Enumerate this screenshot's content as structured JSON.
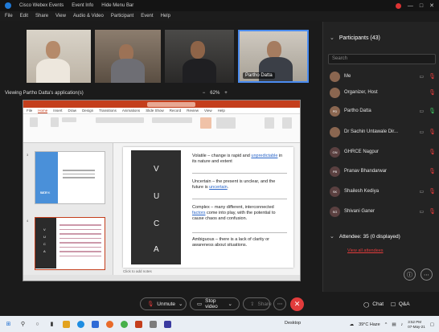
{
  "titlebar": {
    "items": [
      "Cisco Webex Events",
      "Event Info",
      "Hide Menu Bar"
    ],
    "minimize": "—",
    "maximize": "□",
    "close": "✕"
  },
  "menubar": [
    "File",
    "Edit",
    "Share",
    "View",
    "Audio & Video",
    "Participant",
    "Event",
    "Help"
  ],
  "videos": {
    "active_speaker_label": "Partho Datta"
  },
  "share_bar": {
    "viewing_text": "Viewing Partho Datta's application(s)",
    "zoom_out": "−",
    "zoom_level": "62%",
    "zoom_in": "+"
  },
  "ppt": {
    "tabs": [
      "File",
      "Home",
      "Insert",
      "Draw",
      "Design",
      "Transitions",
      "Animations",
      "Slide Show",
      "Record",
      "Review",
      "View",
      "Help"
    ],
    "slide_numbers": [
      "3",
      "4"
    ],
    "thumb1_title": [
      "SET",
      "WORK"
    ],
    "vuca_letters": [
      "V",
      "U",
      "C",
      "A"
    ],
    "slide_text": [
      {
        "prefix": "Volatile – change is rapid and ",
        "hl": "unpredictable",
        "suffix": " in its nature and extent"
      },
      {
        "prefix": "Uncertain – the present is unclear, and the future is ",
        "hl": "uncertain",
        "suffix": "."
      },
      {
        "prefix": "Complex – many different, interconnected ",
        "hl": "factors",
        "suffix": " come into play, with the potential to cause chaos and confusion."
      },
      {
        "prefix": "Ambiguous – there is a lack of clarity or awareness about situations.",
        "hl": "",
        "suffix": ""
      }
    ],
    "notes_placeholder": "Click to add notes"
  },
  "participants": {
    "title": "Participants (43)",
    "search_placeholder": "Search",
    "rows": [
      {
        "name": "Me",
        "avatar": "",
        "photo": true
      },
      {
        "name": "Organizer, Host",
        "avatar": "",
        "photo": true
      },
      {
        "name": "Partho Datta",
        "avatar": "PD",
        "photo": true
      },
      {
        "name": "Dr Sachin Untawale Dir...",
        "avatar": "",
        "photo": true
      },
      {
        "name": "GHRCE Nagpur",
        "avatar": "GN",
        "photo": false
      },
      {
        "name": "Pranav Bhandarwar",
        "avatar": "PB",
        "photo": false
      },
      {
        "name": "Shailesh Kediya",
        "avatar": "SK",
        "photo": false
      },
      {
        "name": "Shivani Ganer",
        "avatar": "SG",
        "photo": false
      }
    ],
    "attendee_header": "Attendee: 35 (0 displayed)",
    "attendee_link": "View all attendees"
  },
  "controls": {
    "unmute": "Unmute",
    "stop_video": "Stop video",
    "share": "Share",
    "chat": "Chat",
    "qa": "Q&A"
  },
  "taskbar": {
    "desktop_label": "Desktop",
    "weather": "39°C Haze",
    "time": "3:52 PM",
    "date": "07-May-21"
  },
  "colors": {
    "ppt_accent": "#c43e1c",
    "slide_blue": "#4a90d9",
    "leave_red": "#e23c3c",
    "active_border": "#4b8cf0"
  }
}
